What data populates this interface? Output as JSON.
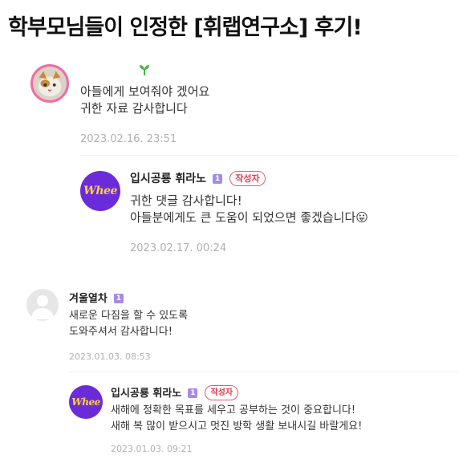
{
  "page": {
    "title": "학부모님들이 인정한 [휘랩연구소] 후기!"
  },
  "comments": [
    {
      "lines": [
        "아들에게 보여줘야 겠어요",
        "귀한 자료 감사합니다"
      ],
      "date": "2023.02.16. 23:51",
      "avatar_icon": "cat-photo-avatar",
      "sprout_icon": "sprout-icon"
    },
    {
      "author": "입시공룡 휘라노",
      "level": "1",
      "badge": "작성자",
      "logo_text": "Whee",
      "lines": [
        "귀한 댓글 감사합니다!",
        "아들분에게도 큰 도움이 되었으면 좋겠습니다"
      ],
      "emoji": "😛",
      "date": "2023.02.17. 00:24"
    },
    {
      "author": "겨울열차",
      "level": "1",
      "lines": [
        "새로운 다짐을 할 수 있도록",
        "도와주셔서 감사합니다!"
      ],
      "date": "2023.01.03. 08:53"
    },
    {
      "author": "입시공룡 휘라노",
      "level": "1",
      "badge": "작성자",
      "logo_text": "Whee",
      "lines": [
        "새해에 정확한 목표를 세우고 공부하는 것이 중요합니다!",
        "새해 복 많이 받으시고 멋진 방학 생활 보내시길 바랄게요!"
      ],
      "date": "2023.01.03. 09:21"
    }
  ],
  "colors": {
    "brand_purple": "#6c2bd9",
    "logo_yellow": "#ffd23f",
    "author_badge": "#e03a50",
    "level_badge": "#a58ae6",
    "date_gray": "#b0b0b0"
  }
}
